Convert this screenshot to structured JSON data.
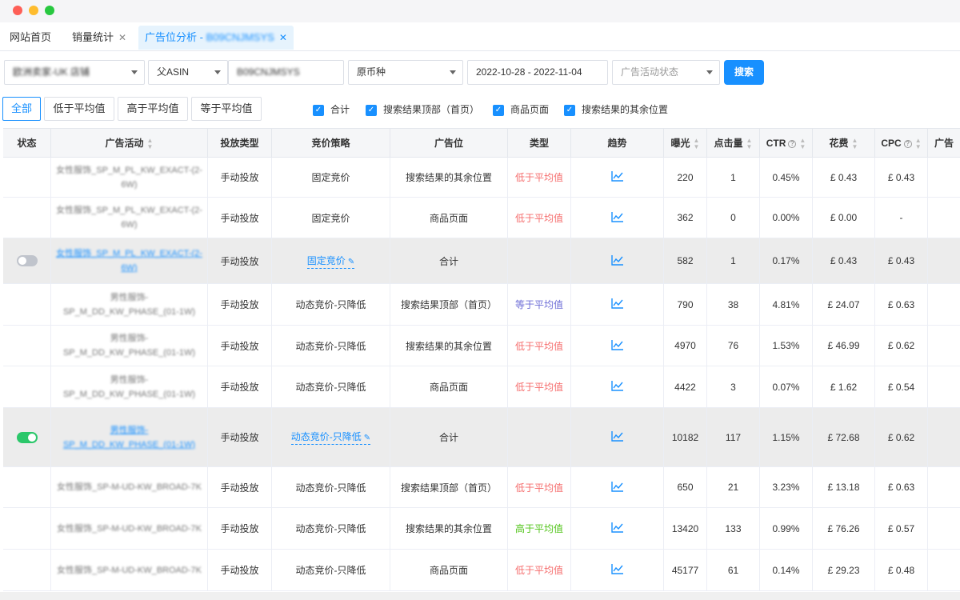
{
  "window": {
    "controls": [
      "close",
      "minimize",
      "maximize"
    ]
  },
  "tabs": [
    {
      "label": "网站首页",
      "closable": false,
      "active": false
    },
    {
      "label": "销量统计",
      "closable": true,
      "active": false
    },
    {
      "label": "广告位分析 - ",
      "suffix_blurred": "B09CNJMSYS",
      "closable": true,
      "active": true
    }
  ],
  "filters": {
    "store": "欧洲卖家-UK 店铺",
    "asin_type": "父ASIN",
    "asin_value": "B09CNJMSYS",
    "currency": "原币种",
    "date_range": "2022-10-28 - 2022-11-04",
    "campaign_status_placeholder": "广告活动状态",
    "search_label": "搜索"
  },
  "segments": [
    "全部",
    "低于平均值",
    "高于平均值",
    "等于平均值"
  ],
  "checkboxes": [
    "合计",
    "搜索结果顶部（首页）",
    "商品页面",
    "搜索结果的其余位置"
  ],
  "columns": {
    "status": "状态",
    "campaign": "广告活动",
    "targeting": "投放类型",
    "bidding": "竞价策略",
    "placement": "广告位",
    "type": "类型",
    "trend": "趋势",
    "impressions": "曝光",
    "clicks": "点击量",
    "ctr": "CTR",
    "spend": "花费",
    "cpc": "CPC",
    "more": "广告"
  },
  "rows": [
    {
      "summary": false,
      "status": "",
      "campaign": "女性服饰_SP_M_PL_KW_EXACT-(2-6W)",
      "targeting": "手动投放",
      "bidding": "固定竞价",
      "placement": "搜索结果的其余位置",
      "type": "低于平均值",
      "type_class": "below",
      "impressions": "220",
      "clicks": "1",
      "ctr": "0.45%",
      "spend": "£ 0.43",
      "cpc": "£ 0.43"
    },
    {
      "summary": false,
      "status": "",
      "campaign": "女性服饰_SP_M_PL_KW_EXACT-(2-6W)",
      "targeting": "手动投放",
      "bidding": "固定竞价",
      "placement": "商品页面",
      "type": "低于平均值",
      "type_class": "below",
      "impressions": "362",
      "clicks": "0",
      "ctr": "0.00%",
      "spend": "£ 0.00",
      "cpc": "-"
    },
    {
      "summary": true,
      "status": "off",
      "campaign": "女性服饰_SP_M_PL_KW_EXACT-(2-6W)",
      "targeting": "手动投放",
      "bidding": "固定竞价",
      "placement": "合计",
      "type": "",
      "type_class": "",
      "impressions": "582",
      "clicks": "1",
      "ctr": "0.17%",
      "spend": "£ 0.43",
      "cpc": "£ 0.43"
    },
    {
      "summary": false,
      "status": "",
      "campaign": "男性服饰-SP_M_DD_KW_PHASE_(01-1W)",
      "targeting": "手动投放",
      "bidding": "动态竞价-只降低",
      "placement": "搜索结果顶部（首页）",
      "type": "等于平均值",
      "type_class": "equal",
      "impressions": "790",
      "clicks": "38",
      "ctr": "4.81%",
      "spend": "£ 24.07",
      "cpc": "£ 0.63"
    },
    {
      "summary": false,
      "status": "",
      "campaign": "男性服饰-SP_M_DD_KW_PHASE_(01-1W)",
      "targeting": "手动投放",
      "bidding": "动态竞价-只降低",
      "placement": "搜索结果的其余位置",
      "type": "低于平均值",
      "type_class": "below",
      "impressions": "4970",
      "clicks": "76",
      "ctr": "1.53%",
      "spend": "£ 46.99",
      "cpc": "£ 0.62"
    },
    {
      "summary": false,
      "status": "",
      "campaign": "男性服饰-SP_M_DD_KW_PHASE_(01-1W)",
      "targeting": "手动投放",
      "bidding": "动态竞价-只降低",
      "placement": "商品页面",
      "type": "低于平均值",
      "type_class": "below",
      "impressions": "4422",
      "clicks": "3",
      "ctr": "0.07%",
      "spend": "£ 1.62",
      "cpc": "£ 0.54"
    },
    {
      "summary": true,
      "status": "on",
      "campaign": "男性服饰-SP_M_DD_KW_PHASE_(01-1W)",
      "targeting": "手动投放",
      "bidding": "动态竞价-只降低",
      "placement": "合计",
      "type": "",
      "type_class": "",
      "impressions": "10182",
      "clicks": "117",
      "ctr": "1.15%",
      "spend": "£ 72.68",
      "cpc": "£ 0.62"
    },
    {
      "summary": false,
      "status": "",
      "campaign": "女性服饰_SP-M-UD-KW_BROAD-7K",
      "targeting": "手动投放",
      "bidding": "动态竞价-只降低",
      "placement": "搜索结果顶部（首页）",
      "type": "低于平均值",
      "type_class": "below",
      "impressions": "650",
      "clicks": "21",
      "ctr": "3.23%",
      "spend": "£ 13.18",
      "cpc": "£ 0.63"
    },
    {
      "summary": false,
      "status": "",
      "campaign": "女性服饰_SP-M-UD-KW_BROAD-7K",
      "targeting": "手动投放",
      "bidding": "动态竞价-只降低",
      "placement": "搜索结果的其余位置",
      "type": "高于平均值",
      "type_class": "above",
      "impressions": "13420",
      "clicks": "133",
      "ctr": "0.99%",
      "spend": "£ 76.26",
      "cpc": "£ 0.57"
    },
    {
      "summary": false,
      "status": "",
      "campaign": "女性服饰_SP-M-UD-KW_BROAD-7K",
      "targeting": "手动投放",
      "bidding": "动态竞价-只降低",
      "placement": "商品页面",
      "type": "低于平均值",
      "type_class": "below",
      "impressions": "45177",
      "clicks": "61",
      "ctr": "0.14%",
      "spend": "£ 29.23",
      "cpc": "£ 0.48"
    }
  ],
  "colors": {
    "accent": "#1890ff",
    "below": "#f56c6c",
    "equal": "#6b6bd6",
    "above": "#52c41a",
    "toggle_on": "#2bc76a",
    "toggle_off": "#c0c4cc",
    "summary_bg": "#ececec"
  },
  "icons": {
    "trend": "line-chart-icon",
    "edit": "pencil-icon",
    "help": "question-circle-icon",
    "sort": "sort-icon",
    "caret": "caret-down-icon",
    "check": "check-icon",
    "close": "close-icon"
  }
}
